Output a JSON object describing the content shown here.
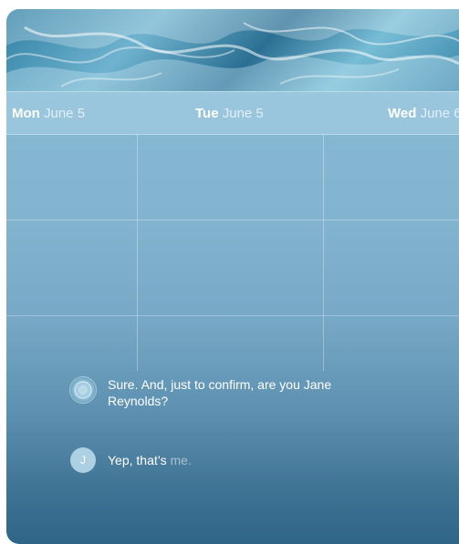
{
  "days": [
    {
      "name": "Mon",
      "date": "June 5"
    },
    {
      "name": "Tue",
      "date": "June 5"
    },
    {
      "name": "Wed",
      "date": "June 6"
    }
  ],
  "conversation": {
    "agent_message": "Sure. And, just to confirm, are you Jane Reynolds?",
    "user_initial": "J",
    "user_reply_text": "Yep, that’s",
    "user_reply_pending": "me."
  },
  "colors": {
    "sky_top": "#8ec0d8",
    "sky_bottom": "#2f6587",
    "wave_header": "#2f7fa3"
  },
  "icons": {
    "header": "ocean-wave-image",
    "agent_avatar": "assistant-orb-icon",
    "user_avatar": "user-initial-avatar"
  }
}
